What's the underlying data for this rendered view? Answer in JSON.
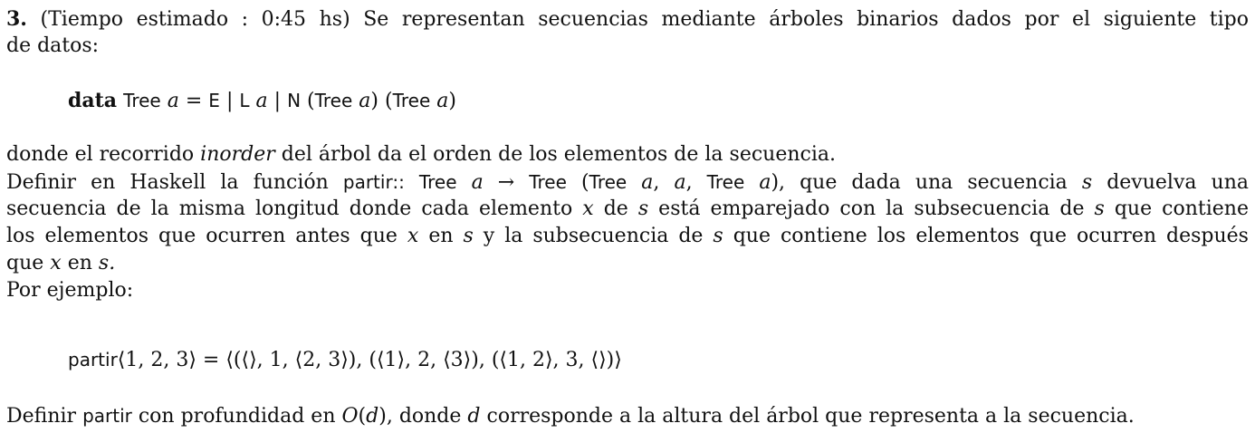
{
  "problem": {
    "number": "3.",
    "line1_rest": "(Tiempo estimado : 0:45 hs) Se representan secuencias mediante árboles binarios dados por el siguiente tipo",
    "line2": "de datos:"
  },
  "datatype": {
    "keyword": "data",
    "tree1": "Tree",
    "var_a1": "a",
    "eq": "=",
    "ctor_E": "E",
    "bar1": "|",
    "ctor_L": "L",
    "var_a2": "a",
    "bar2": "|",
    "ctor_N": "N",
    "lp1": "(",
    "tree2": "Tree",
    "var_a3": "a",
    "rp1": ")",
    "lp2": "(",
    "tree3": "Tree",
    "var_a4": "a",
    "rp2": ")"
  },
  "para": {
    "l1_a": "donde el recorrido",
    "l1_inorder": "inorder",
    "l1_b": "del árbol da el orden de los elementos de la secuencia.",
    "l2_a": "Definir en Haskell la función",
    "l2_partir": "partir",
    "l2_sig": "::",
    "l2_tree1": "Tree",
    "l2_a1": "a",
    "l2_arrow": "→",
    "l2_tree2": "Tree",
    "l2_paren_open": "(",
    "l2_tree3": "Tree",
    "l2_a2": "a",
    "l2_comma1": ",",
    "l2_a3": "a",
    "l2_comma2": ",",
    "l2_tree4": "Tree",
    "l2_a4": "a",
    "l2_paren_close": "),",
    "l2_b": "que dada una secuencia",
    "l2_s": "s",
    "l2_c": "devuelva una",
    "l3_a": "secuencia de la misma longitud donde cada elemento",
    "l3_x": "x",
    "l3_b": "de",
    "l3_s1": "s",
    "l3_c": "está emparejado con la subsecuencia de",
    "l3_s2": "s",
    "l3_d": "que contiene",
    "l4_a": "los elementos que ocurren antes que",
    "l4_x": "x",
    "l4_b": "en",
    "l4_s1": "s",
    "l4_c": "y la subsecuencia de",
    "l4_s2": "s",
    "l4_d": "que contiene los elementos que ocurren después",
    "l5_a": "que",
    "l5_x": "x",
    "l5_b": "en",
    "l5_s": "s.",
    "l6": "Por ejemplo:"
  },
  "example": {
    "func": "partir",
    "formula": "⟨1, 2, 3⟩ = ⟨(⟨⟩, 1, ⟨2, 3⟩), (⟨1⟩, 2, ⟨3⟩), (⟨1, 2⟩, 3, ⟨⟩)⟩"
  },
  "final": {
    "a": "Definir",
    "partir": "partir",
    "b": "con profundidad en",
    "O": "O",
    "paren_open": "(",
    "d1": "d",
    "paren_close": "),",
    "c": "donde",
    "d2": "d",
    "e": "corresponde a la altura del árbol que representa a la secuencia."
  }
}
